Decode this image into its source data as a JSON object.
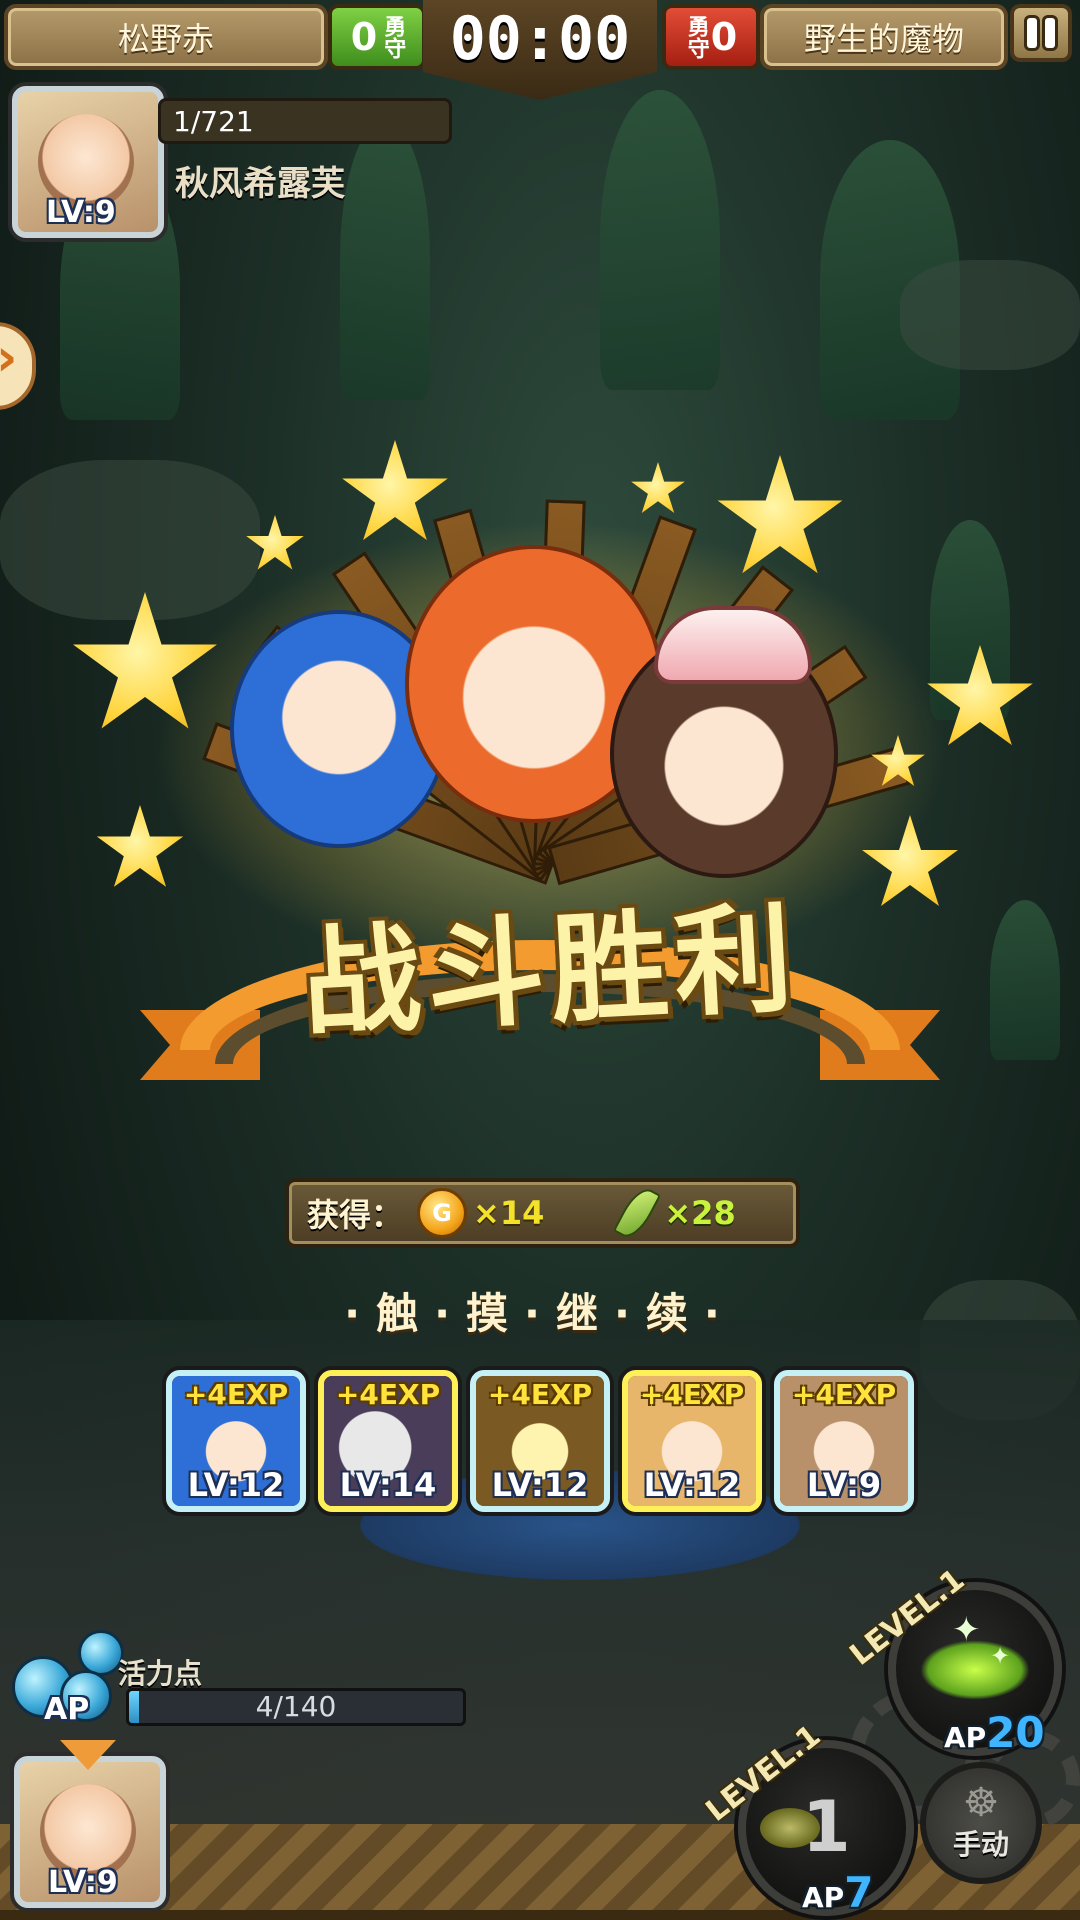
{
  "top_bar": {
    "player_name": "松野赤",
    "player_score": "0",
    "score_tag": "勇守",
    "timer": "00:00",
    "enemy_score": "0",
    "enemy_name": "野生的魔物"
  },
  "player": {
    "level": "LV:9",
    "hp": "1/721",
    "name": "秋风希露芙"
  },
  "victory": {
    "title": "战斗胜利",
    "reward_label": "获得：",
    "coin_symbol": "G",
    "coin_amount": "×14",
    "feather_amount": "×28",
    "tap_continue": "·触·摸·继·续·"
  },
  "party": [
    {
      "gain": "+4EXP",
      "level": "LV:12",
      "frame": "silver",
      "art": "blue-hair-catgirl"
    },
    {
      "gain": "+4EXP",
      "level": "LV:14",
      "frame": "gold",
      "art": "masked-character"
    },
    {
      "gain": "+4EXP",
      "level": "LV:12",
      "frame": "silver",
      "art": "glowing-hero"
    },
    {
      "gain": "+4EXP",
      "level": "LV:12",
      "frame": "gold",
      "art": "blonde-fairy"
    },
    {
      "gain": "+4EXP",
      "level": "LV:9",
      "frame": "silver",
      "art": "brown-hair-girl"
    }
  ],
  "ap": {
    "label": "活力点",
    "tag": "AP",
    "value": "4/140",
    "fill_fraction": 0.03
  },
  "bottom_portrait": {
    "level": "LV:9"
  },
  "skills": [
    {
      "level_label": "LEVEL.1",
      "ap_label": "AP",
      "ap_cost": "20"
    },
    {
      "level_label": "LEVEL.1",
      "ap_label": "AP",
      "ap_cost": "7",
      "count": "1"
    }
  ],
  "manual_label": "手动",
  "colors": {
    "ribbon_orange": "#f39b2e",
    "title_yellow": "#fdf3a8",
    "exp_gold": "#ffe23b",
    "ap_blue": "#3fb5ff",
    "score_green": "#3f8d1d",
    "score_red": "#a51f12"
  }
}
